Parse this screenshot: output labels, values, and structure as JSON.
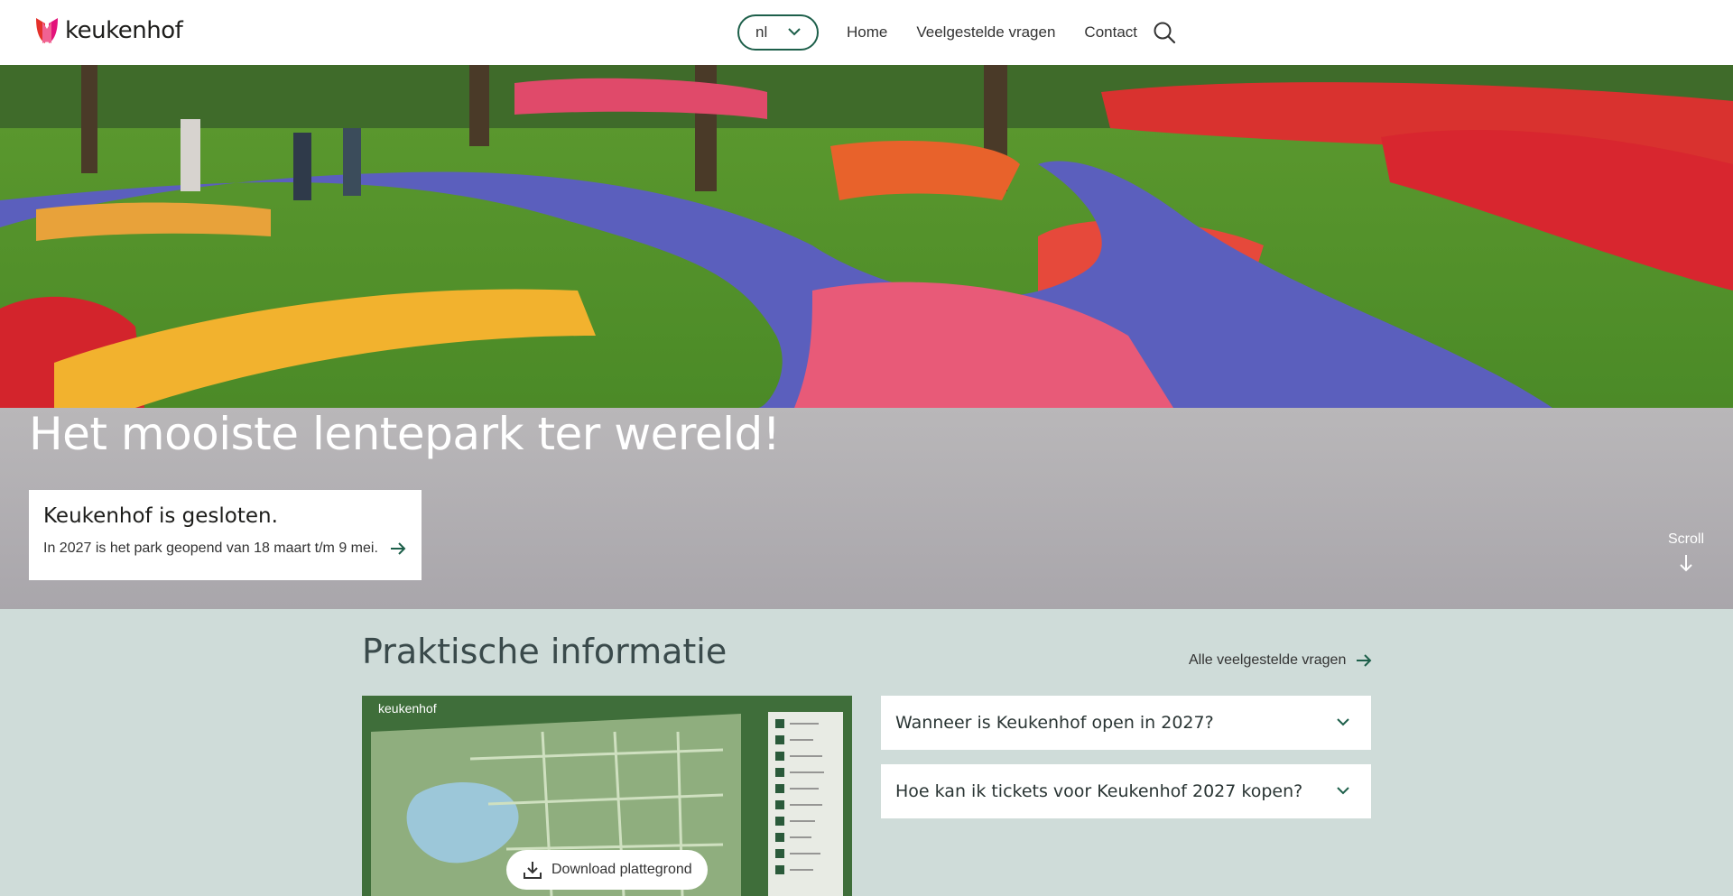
{
  "brand": {
    "name": "keukenhof"
  },
  "header": {
    "lang_value": "nl",
    "nav": [
      "Home",
      "Veelgestelde vragen",
      "Contact"
    ]
  },
  "hero": {
    "title": "Het mooiste lentepark ter wereld!",
    "card_title": "Keukenhof is gesloten.",
    "card_text": "In 2027 is het park geopend van 18 maart t/m 9 mei.",
    "scroll_label": "Scroll"
  },
  "practical": {
    "title": "Praktische informatie",
    "faq_link": "Alle veelgestelde vragen",
    "map_logo": "keukenhof",
    "map_download": "Download plattegrond",
    "faqs": [
      "Wanneer is Keukenhof open in 2027?",
      "Hoe kan ik tickets voor Keukenhof 2027 kopen?"
    ]
  },
  "colors": {
    "accent": "#1d5f4a",
    "logo_pink": "#e3127a",
    "logo_red": "#e4312b",
    "band": "#cfdcd9"
  }
}
